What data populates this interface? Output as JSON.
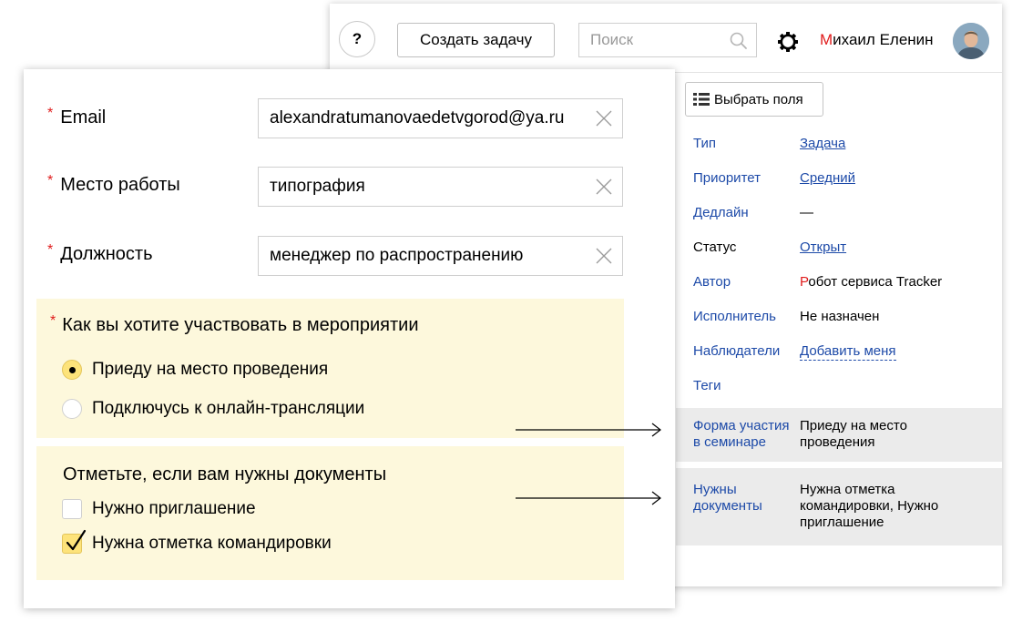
{
  "header": {
    "help_label": "?",
    "create_task_label": "Создать задачу",
    "search_placeholder": "Поиск",
    "user": {
      "first_name": "Михаил",
      "last_name": "Еленин"
    }
  },
  "issue": {
    "choose_fields_label": "Выбрать поля",
    "properties": [
      {
        "key": "Тип",
        "value": "Задача"
      },
      {
        "key": "Приоритет",
        "value": "Средний"
      },
      {
        "key": "Дедлайн",
        "value": "—"
      },
      {
        "key": "Статус",
        "value": "Открыт"
      },
      {
        "key": "Автор",
        "value_first": "Р",
        "value_rest": "обот сервиса Tracker"
      },
      {
        "key": "Исполнитель",
        "value": "Не назначен"
      },
      {
        "key": "Наблюдатели",
        "value": "Добавить меня"
      },
      {
        "key": "Теги",
        "value": ""
      },
      {
        "key_line1": "Форма участия",
        "key_line2": "в семинаре",
        "value_line1": "Приеду на место",
        "value_line2": "проведения"
      },
      {
        "key_line1": "Нужны",
        "key_line2": "документы",
        "value_line1": "Нужна отметка",
        "value_line2": "командировки, Нужно",
        "value_line3": "приглашение"
      }
    ]
  },
  "form": {
    "required_mark": "*",
    "email": {
      "label": "Email",
      "value": "alexandratumanovaedetvgorod@ya.ru"
    },
    "workplace": {
      "label": "Место работы",
      "value": "типография"
    },
    "position": {
      "label": "Должность",
      "value": "менеджер по распространению"
    },
    "participation": {
      "question": "Как вы хотите участвовать в мероприятии",
      "options": [
        {
          "label": "Приеду на место проведения",
          "selected": true
        },
        {
          "label": "Подключусь к онлайн-трансляции",
          "selected": false
        }
      ]
    },
    "documents": {
      "question": "Отметьте, если вам нужны документы",
      "options": [
        {
          "label": "Нужно приглашение",
          "checked": false
        },
        {
          "label": "Нужна отметка командировки",
          "checked": true
        }
      ]
    }
  },
  "colors": {
    "accent_red": "#e01c1c",
    "link_blue": "#1d4aa8",
    "section_bg": "#fdf8dc",
    "control_yellow": "#fde37a",
    "highlight_row": "#ebebeb"
  }
}
